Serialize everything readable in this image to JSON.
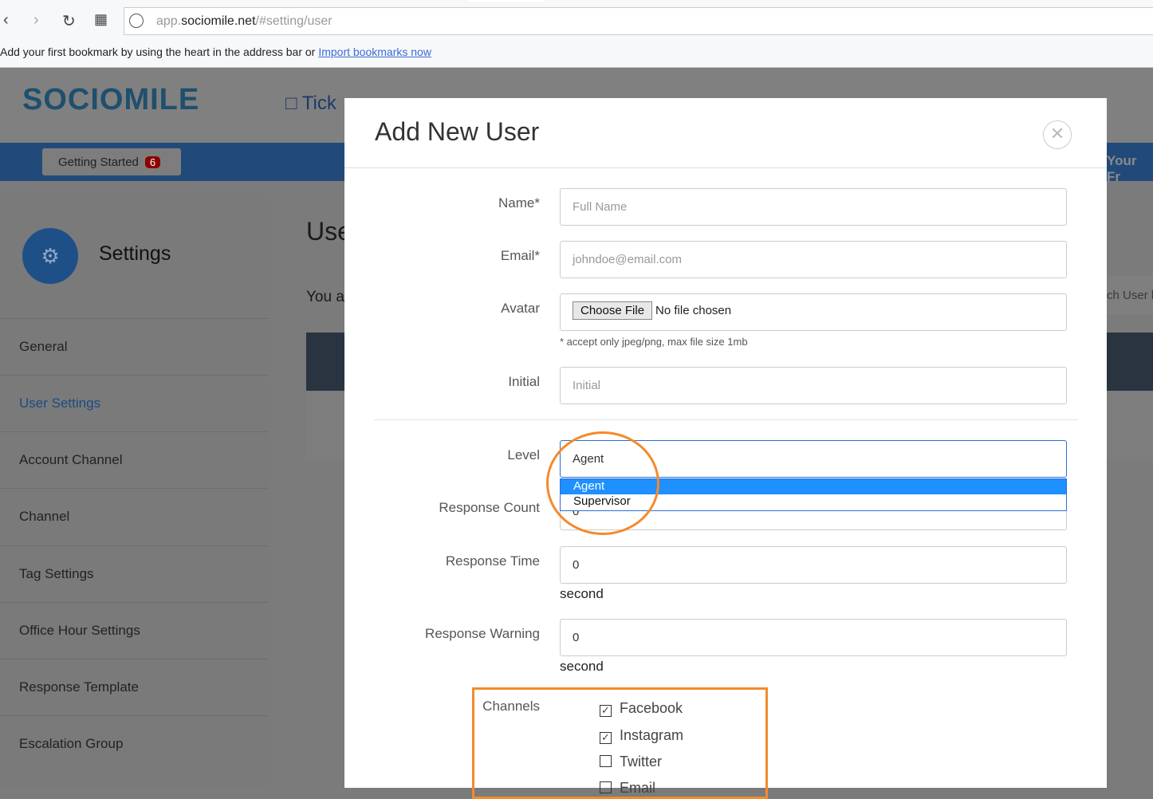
{
  "browser": {
    "url_prefix": "app.",
    "url_host": "sociomile.net",
    "url_path": "/#setting/user",
    "bookmark_text": "Add your first bookmark by using the heart in the address bar or",
    "bookmark_link": "Import bookmarks now"
  },
  "app": {
    "logo": "SOCIOMILE",
    "nav_partial": "Tick",
    "getting_started": "Getting Started",
    "getting_started_count": "6",
    "right_partial": "Your Fr",
    "search_partial": "ch User b"
  },
  "sidebar": {
    "title": "Settings",
    "items": [
      {
        "label": "General"
      },
      {
        "label": "User Settings",
        "active": true
      },
      {
        "label": "Account Channel"
      },
      {
        "label": "Channel"
      },
      {
        "label": "Tag Settings"
      },
      {
        "label": "Office Hour Settings"
      },
      {
        "label": "Response Template"
      },
      {
        "label": "Escalation Group"
      }
    ]
  },
  "main": {
    "title_partial": "Use",
    "subtitle_partial": "You a"
  },
  "modal": {
    "title": "Add New User",
    "name_label": "Name*",
    "name_placeholder": "Full Name",
    "email_label": "Email*",
    "email_placeholder": "johndoe@email.com",
    "avatar_label": "Avatar",
    "choose_file": "Choose File",
    "no_file": "No file chosen",
    "avatar_hint": "* accept only jpeg/png, max file size 1mb",
    "initial_label": "Initial",
    "initial_placeholder": "Initial",
    "level_label": "Level",
    "level_value": "Agent",
    "level_options": [
      "Agent",
      "Supervisor"
    ],
    "response_count_label": "Response Count",
    "response_count_value": "0",
    "response_time_label": "Response Time",
    "response_time_value": "0",
    "response_time_unit": "second",
    "response_warning_label": "Response Warning",
    "response_warning_value": "0",
    "response_warning_unit": "second",
    "channels_label": "Channels",
    "channels": [
      {
        "label": "Facebook",
        "checked": true
      },
      {
        "label": "Instagram",
        "checked": true
      },
      {
        "label": "Twitter",
        "checked": false
      },
      {
        "label": "Email",
        "checked": false
      }
    ]
  },
  "colors": {
    "annotation": "#f58a2b",
    "selected_option": "#1e90ff",
    "brand_blue": "#214a7a"
  }
}
